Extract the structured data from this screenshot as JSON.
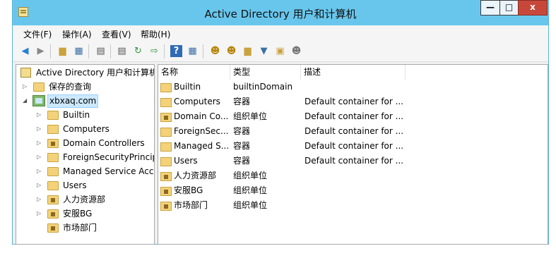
{
  "window": {
    "title": "Active Directory 用户和计算机",
    "controls": {
      "minimize": "—",
      "maximize": "□",
      "close": "x"
    }
  },
  "menu": [
    "文件(F)",
    "操作(A)",
    "查看(V)",
    "帮助(H)"
  ],
  "toolbar_icons": [
    "back-icon",
    "forward-icon",
    "up-folder-icon",
    "show-tree-icon",
    "properties-icon",
    "export-list-icon",
    "refresh-icon",
    "export-icon",
    "help-icon",
    "view-icon",
    "user-icon",
    "group-icon",
    "ou-icon",
    "filter-icon",
    "find-icon",
    "delegate-icon"
  ],
  "tree": {
    "root": "Active Directory 用户和计算机",
    "saved_queries": "保存的查询",
    "domain": "xbxaq.com",
    "children": [
      {
        "label": "Builtin",
        "ou": false
      },
      {
        "label": "Computers",
        "ou": false
      },
      {
        "label": "Domain Controllers",
        "ou": true
      },
      {
        "label": "ForeignSecurityPrincipa",
        "ou": false
      },
      {
        "label": "Managed Service Acco",
        "ou": false
      },
      {
        "label": "Users",
        "ou": false
      },
      {
        "label": "人力资源部",
        "ou": true
      },
      {
        "label": "安服BG",
        "ou": true
      },
      {
        "label": "市场部门",
        "ou": true
      }
    ]
  },
  "list": {
    "columns": [
      "名称",
      "类型",
      "描述"
    ],
    "rows": [
      {
        "name": "Builtin",
        "type": "builtinDomain",
        "desc": "",
        "ou": false
      },
      {
        "name": "Computers",
        "type": "容器",
        "desc": "Default container for ...",
        "ou": false
      },
      {
        "name": "Domain Co...",
        "type": "组织单位",
        "desc": "Default container for ...",
        "ou": true
      },
      {
        "name": "ForeignSec...",
        "type": "容器",
        "desc": "Default container for ...",
        "ou": false
      },
      {
        "name": "Managed S...",
        "type": "容器",
        "desc": "Default container for ...",
        "ou": false
      },
      {
        "name": "Users",
        "type": "容器",
        "desc": "Default container for ...",
        "ou": false
      },
      {
        "name": "人力资源部",
        "type": "组织单位",
        "desc": "",
        "ou": true
      },
      {
        "name": "安服BG",
        "type": "组织单位",
        "desc": "",
        "ou": true
      },
      {
        "name": "市场部门",
        "type": "组织单位",
        "desc": "",
        "ou": true
      }
    ]
  }
}
